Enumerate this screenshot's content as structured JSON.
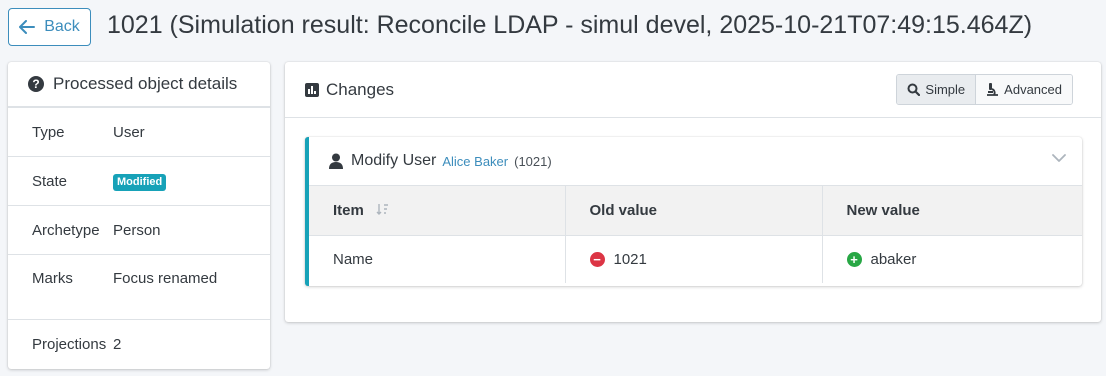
{
  "header": {
    "back_label": "Back",
    "title": "1021 (Simulation result: Reconcile LDAP - simul devel, 2025-10-21T07:49:15.464Z)"
  },
  "details": {
    "title": "Processed object details",
    "rows": [
      {
        "key": "Type",
        "value": "User"
      },
      {
        "key": "State",
        "value": "Modified"
      },
      {
        "key": "Archetype",
        "value": "Person"
      },
      {
        "key": "Marks",
        "value": "Focus renamed"
      },
      {
        "key": "Projections",
        "value": "2"
      }
    ]
  },
  "changes": {
    "title": "Changes",
    "view_simple": "Simple",
    "view_advanced": "Advanced",
    "active_view": "Simple",
    "delta": {
      "operation": "Modify User",
      "object_name": "Alice Baker",
      "object_id": "(1021)",
      "columns": [
        "Item",
        "Old value",
        "New value"
      ],
      "rows": [
        {
          "item": "Name",
          "old": "1021",
          "new": "abaker"
        }
      ]
    }
  },
  "colors": {
    "accent": "#3c8dbc",
    "info": "#17a2b8",
    "removed": "#dc3545",
    "added": "#28a745"
  },
  "icons": {
    "back": "arrow-left-icon",
    "details": "question-circle-icon",
    "changes": "bar-chart-icon",
    "simple": "search-icon",
    "advanced": "microscope-icon",
    "user": "user-icon",
    "collapse": "chevron-down-icon",
    "sort": "sort-icon",
    "removed": "minus-circle-icon",
    "added": "plus-circle-icon"
  }
}
